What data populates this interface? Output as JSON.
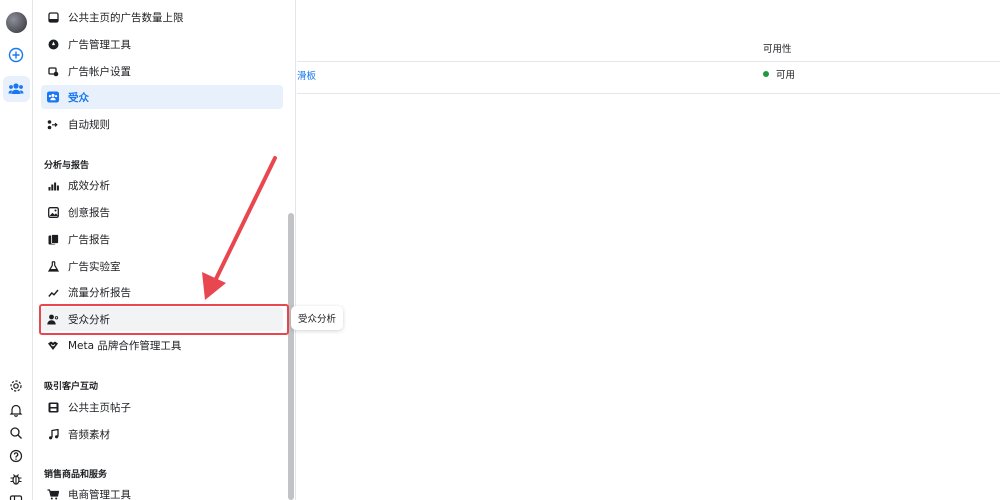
{
  "menu": {
    "items": [
      {
        "label": "公共主页的广告数量上限",
        "icon": "ad-limit-icon"
      },
      {
        "label": "广告管理工具",
        "icon": "ads-manager-icon"
      },
      {
        "label": "广告帐户设置",
        "icon": "account-settings-icon"
      },
      {
        "label": "受众",
        "icon": "audiences-icon"
      },
      {
        "label": "自动规则",
        "icon": "automated-rules-icon"
      }
    ],
    "sections": [
      {
        "title": "分析与报告",
        "items": [
          {
            "label": "成效分析",
            "icon": "bar-chart-icon"
          },
          {
            "label": "创意报告",
            "icon": "image-report-icon"
          },
          {
            "label": "广告报告",
            "icon": "ads-report-icon"
          },
          {
            "label": "广告实验室",
            "icon": "flask-icon"
          },
          {
            "label": "流量分析报告",
            "icon": "trend-icon"
          },
          {
            "label": "受众分析",
            "icon": "audience-insights-icon"
          },
          {
            "label": "Meta 品牌合作管理工具",
            "icon": "handshake-icon"
          }
        ]
      },
      {
        "title": "吸引客户互动",
        "items": [
          {
            "label": "公共主页帖子",
            "icon": "page-posts-icon"
          },
          {
            "label": "音频素材",
            "icon": "music-note-icon"
          }
        ]
      },
      {
        "title": "销售商品和服务",
        "items": [
          {
            "label": "电商管理工具",
            "icon": "cart-icon"
          }
        ]
      }
    ]
  },
  "tooltip": {
    "text": "受众分析"
  },
  "table": {
    "columns": [
      "可用性"
    ],
    "rows": [
      {
        "name_fragment": "滑板",
        "availability": "可用"
      }
    ]
  },
  "colors": {
    "accent": "#1877f2",
    "highlight_border": "#e8474f",
    "available": "#1e9a3e"
  }
}
